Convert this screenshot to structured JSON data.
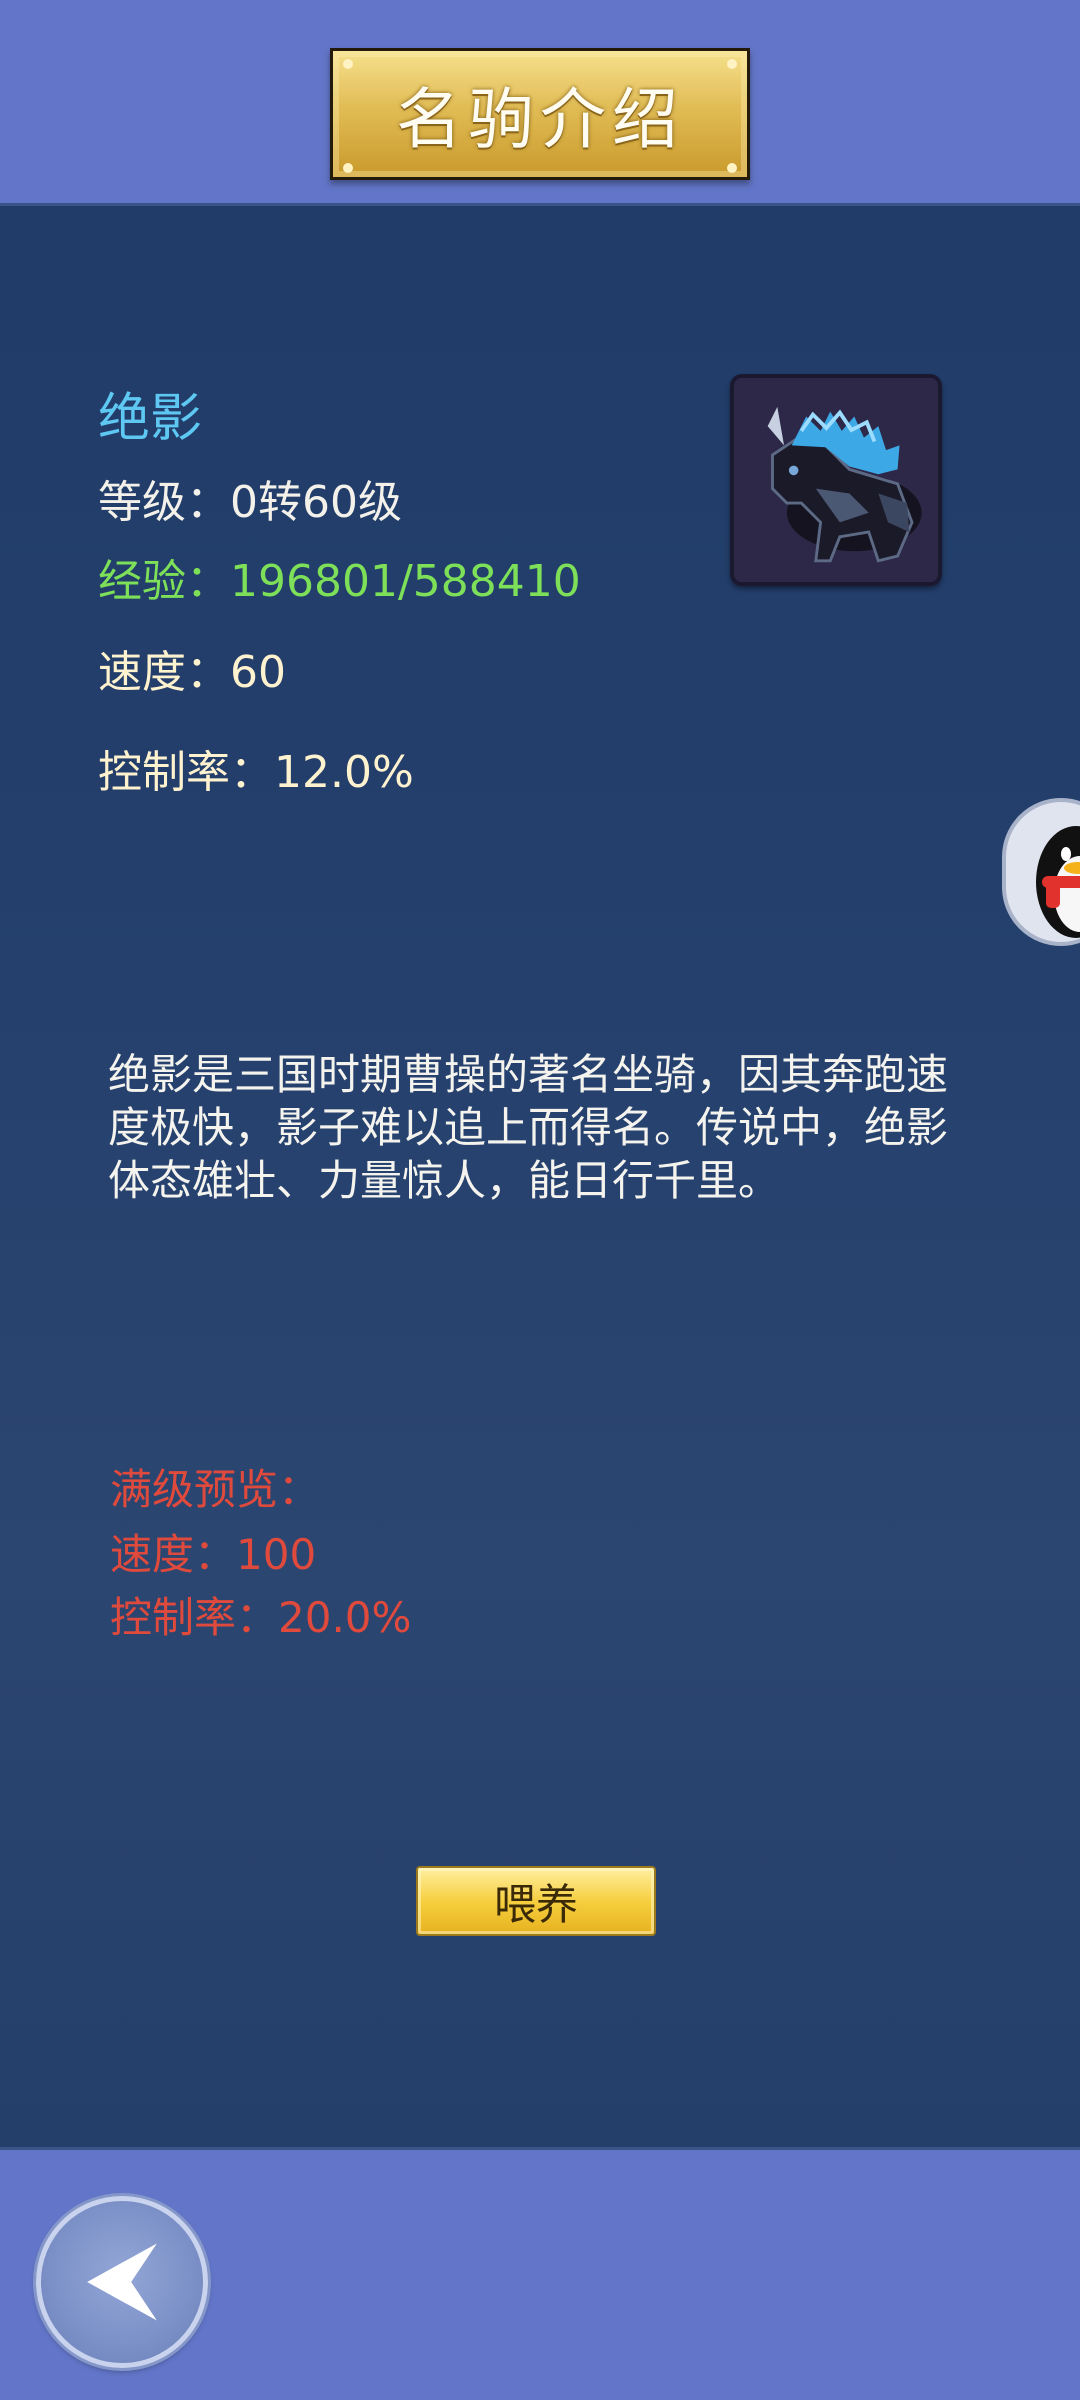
{
  "header": {
    "title": "名驹介绍"
  },
  "mount": {
    "name": "绝影",
    "level": "等级：0转60级",
    "exp": "经验：196801/588410",
    "speed": "速度：60",
    "control_rate": "控制率：12.0%",
    "portrait_icon": "blue-maned-warhorse"
  },
  "description": "绝影是三国时期曹操的著名坐骑，因其奔跑速度极快，影子难以追上而得名。传说中，绝影体态雄壮、力量惊人，能日行千里。",
  "max_preview": {
    "title": "满级预览：",
    "speed": "速度：100",
    "control_rate": "控制率：20.0%"
  },
  "actions": {
    "feed_label": "喂养"
  },
  "colors": {
    "frame": "#6275c8",
    "panel": "#243f6c",
    "name": "#5ec8f2",
    "exp": "#7de058",
    "stat": "#fff2cf",
    "preview": "#df4a3d",
    "gold": "#e1bc55"
  }
}
